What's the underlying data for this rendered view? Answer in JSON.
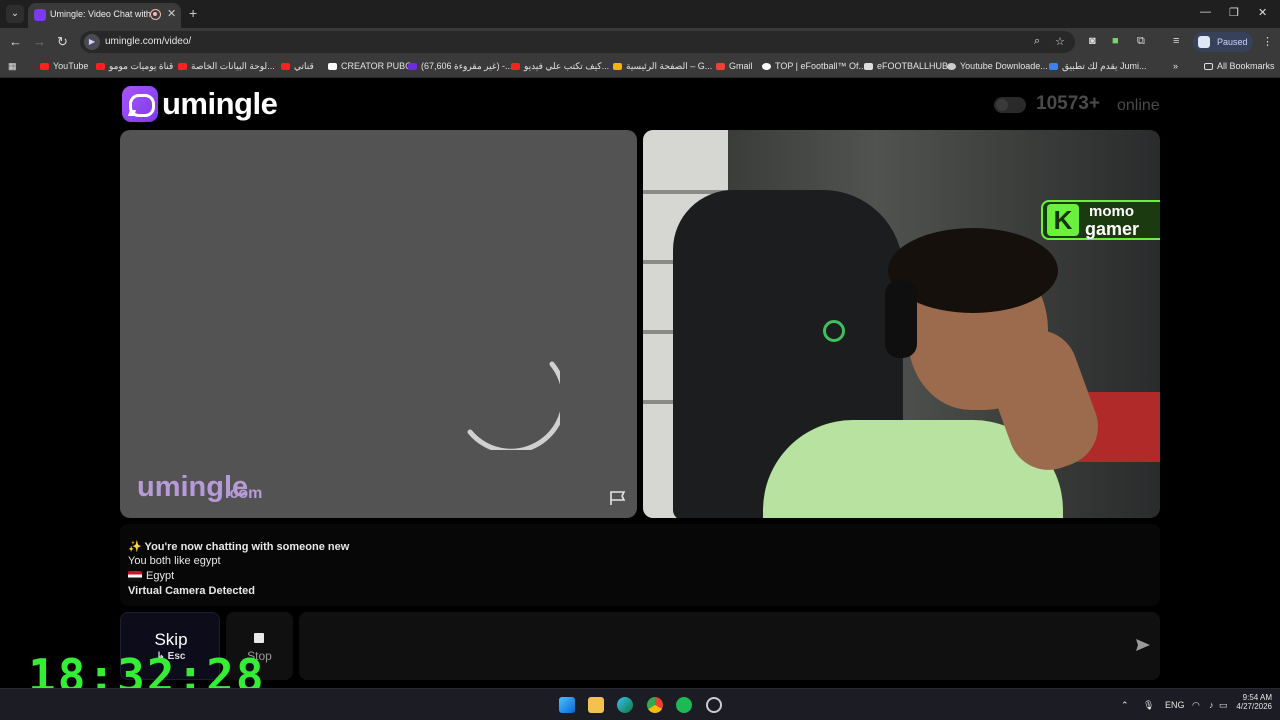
{
  "browser": {
    "tab_title": "Umingle: Video Chat with S",
    "url": "umingle.com/video/",
    "profile_status": "Paused",
    "bookmarks": [
      "YouTube",
      "قناة يوميات مومو",
      "لوحة البيانات الخاصة...",
      "قناتي",
      "CREATOR PUBG",
      "(67,606 غير مقروءة) -...",
      "كيف تكتب علي فيديو...",
      "الصفحة الرئيسية – G...",
      "Gmail",
      "TOP | eFootball™ Of...",
      "eFOOTBALLHUB",
      "Youtube Downloade...",
      "يقدم لك تطبيق Jumi...",
      "All Bookmarks"
    ]
  },
  "site": {
    "logo_text": "umingle",
    "online_count": "10573+",
    "online_label": "online"
  },
  "video": {
    "watermark_main": "umingle",
    "watermark_suffix": ".com",
    "stream_logo_line1": "momo",
    "stream_logo_line2": "gamer",
    "stream_logo_letter": "K"
  },
  "chat": {
    "messages": {
      "intro": "✨ You're now chatting with someone new",
      "common": "You both like egypt",
      "country": "Egypt",
      "warning": "Virtual Camera Detected"
    }
  },
  "controls": {
    "skip_label": "Skip",
    "skip_hint": "↳ Esc",
    "stop_label": "Stop"
  },
  "overlay": {
    "clock": "18:32:28"
  },
  "taskbar": {
    "language": "ENG",
    "time": "9:54 AM",
    "date": "4/27/2026"
  }
}
